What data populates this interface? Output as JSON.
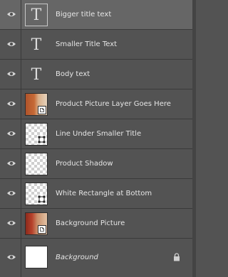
{
  "panel": "layers",
  "layers": [
    {
      "name": "Bigger title text",
      "type": "text",
      "visible": true,
      "selected": true,
      "thumb_glyph": "T"
    },
    {
      "name": "Smaller Title Text",
      "type": "text",
      "visible": true,
      "selected": false,
      "thumb_glyph": "T"
    },
    {
      "name": "Body text",
      "type": "text",
      "visible": true,
      "selected": false,
      "thumb_glyph": "T"
    },
    {
      "name": "Product Picture Layer Goes Here",
      "type": "smart-object",
      "visible": true,
      "selected": false
    },
    {
      "name": "Line Under Smaller Title",
      "type": "shape",
      "visible": true,
      "selected": false
    },
    {
      "name": "Product Shadow",
      "type": "pixel",
      "visible": true,
      "selected": false
    },
    {
      "name": "White Rectangle at Bottom",
      "type": "shape",
      "visible": true,
      "selected": false
    },
    {
      "name": "Background Picture",
      "type": "smart-object",
      "visible": true,
      "selected": false
    },
    {
      "name": "Background",
      "type": "background",
      "visible": true,
      "selected": false,
      "locked": true,
      "italic": true
    }
  ],
  "colors": {
    "panel_bg": "#535353",
    "selected_bg": "#666666",
    "text": "#e6e6e6",
    "divider": "#3a3a3a"
  },
  "icons": {
    "visibility": "eye-icon",
    "lock": "lock-icon",
    "smart_object_badge": "smart-object-badge-icon",
    "shape_badge": "vector-shape-badge-icon"
  }
}
